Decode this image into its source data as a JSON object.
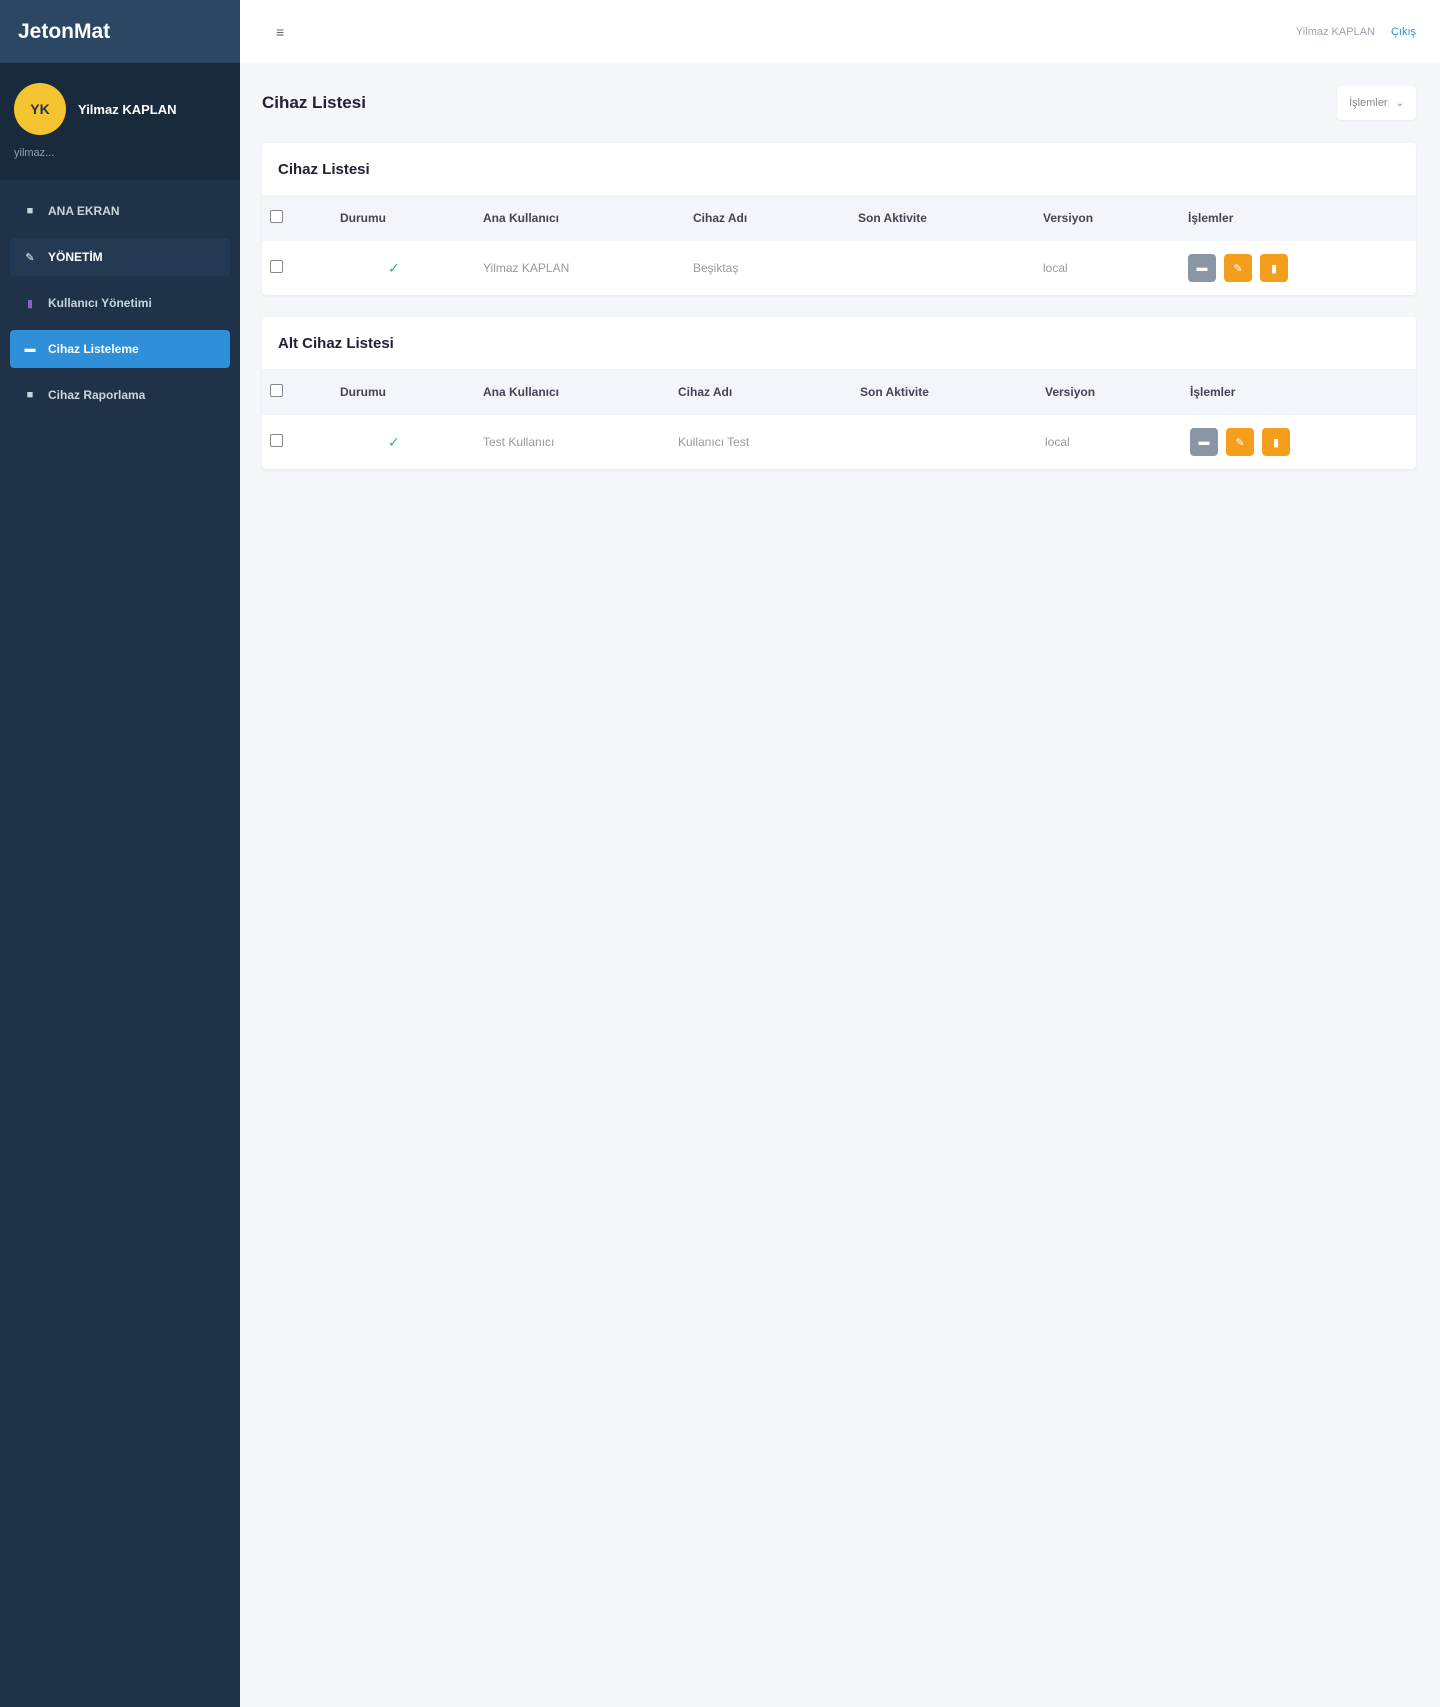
{
  "app": {
    "brand": "JetonMat"
  },
  "user": {
    "initials": "YK",
    "name": "Yilmaz KAPLAN",
    "sub": "yilmaz..."
  },
  "sidebar": {
    "items": [
      {
        "label": "ANA EKRAN",
        "icon": "home-icon"
      },
      {
        "label": "YÖNETİM",
        "icon": "wrench-icon"
      },
      {
        "label": "Kullanıcı Yönetimi",
        "icon": "user-icon"
      },
      {
        "label": "Cihaz Listeleme",
        "icon": "list-icon"
      },
      {
        "label": "Cihaz Raporlama",
        "icon": "report-icon"
      }
    ]
  },
  "topbar": {
    "user": "Yilmaz KAPLAN",
    "logout": "Çıkış"
  },
  "page": {
    "title": "Cihaz Listesi",
    "ops_label": "İşlemler"
  },
  "device_table": {
    "title": "Cihaz Listesi",
    "columns": [
      "Durumu",
      "Ana Kullanıcı",
      "Cihaz Adı",
      "Son Aktivite",
      "Versiyon",
      "İşlemler"
    ],
    "rows": [
      {
        "status": "✓",
        "owner": "Yilmaz KAPLAN",
        "device": "Beşiktaş",
        "last": "",
        "version": "local"
      }
    ]
  },
  "sub_table": {
    "title": "Alt Cihaz Listesi",
    "columns": [
      "Durumu",
      "Ana Kullanıcı",
      "Cihaz Adı",
      "Son Aktivite",
      "Versiyon",
      "İşlemler"
    ],
    "rows": [
      {
        "status": "✓",
        "owner": "Test Kullanıcı",
        "device": "Kullanıcı Test",
        "last": "",
        "version": "local"
      }
    ]
  },
  "colors": {
    "sidebar": "#1f3247",
    "active": "#2f8fd8",
    "accent": "#f59e1b",
    "ok": "#2eb85c"
  }
}
